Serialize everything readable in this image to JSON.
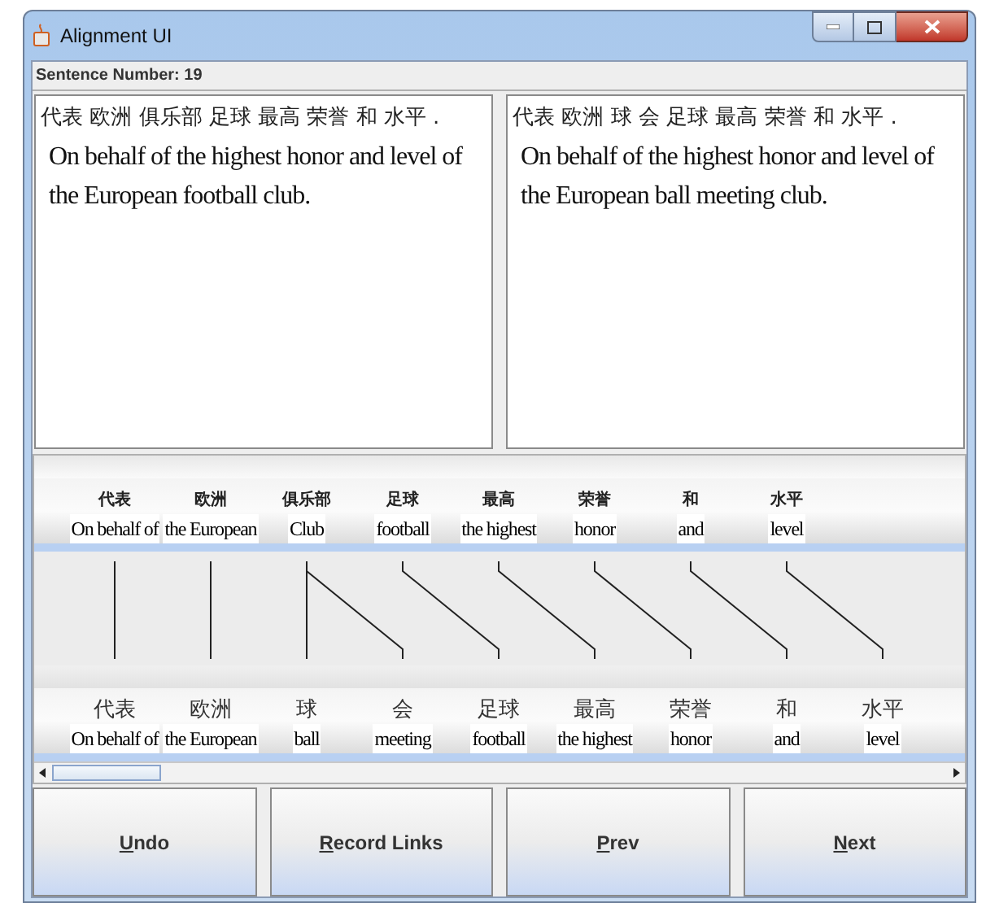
{
  "window": {
    "title": "Alignment UI"
  },
  "sentence_label": "Sentence Number: 19",
  "panels": [
    {
      "chinese": "代表 欧洲 俱乐部 足球 最高 荣誉 和 水平 .",
      "english": "On behalf of the highest honor and level of the European football club."
    },
    {
      "chinese": "代表 欧洲 球 会 足球 最高 荣誉 和 水平 .",
      "english": "On behalf of the highest honor and level of the European ball meeting club."
    }
  ],
  "source_words": [
    {
      "chinese": "代表",
      "english": "On behalf of"
    },
    {
      "chinese": "欧洲",
      "english": "the European"
    },
    {
      "chinese": "俱乐部",
      "english": "Club"
    },
    {
      "chinese": "足球",
      "english": "football"
    },
    {
      "chinese": "最高",
      "english": "the highest"
    },
    {
      "chinese": "荣誉",
      "english": "honor"
    },
    {
      "chinese": "和",
      "english": "and"
    },
    {
      "chinese": "水平",
      "english": "level"
    }
  ],
  "target_words": [
    {
      "chinese": "代表",
      "english": "On behalf of",
      "kind": "straight"
    },
    {
      "chinese": "欧洲",
      "english": "the European",
      "kind": "straight"
    },
    {
      "chinese": "球",
      "english": "ball",
      "kind": "straight"
    },
    {
      "chinese": "会",
      "english": "meeting",
      "kind": "diagonal"
    },
    {
      "chinese": "足球",
      "english": "football",
      "kind": "diagonal"
    },
    {
      "chinese": "最高",
      "english": "the highest",
      "kind": "diagonal"
    },
    {
      "chinese": "荣誉",
      "english": "honor",
      "kind": "diagonal"
    },
    {
      "chinese": "和",
      "english": "and",
      "kind": "diagonal"
    },
    {
      "chinese": "水平",
      "english": "level",
      "kind": "diagonal"
    }
  ],
  "buttons": [
    "Undo",
    "Record Links",
    "Prev",
    "Next"
  ]
}
